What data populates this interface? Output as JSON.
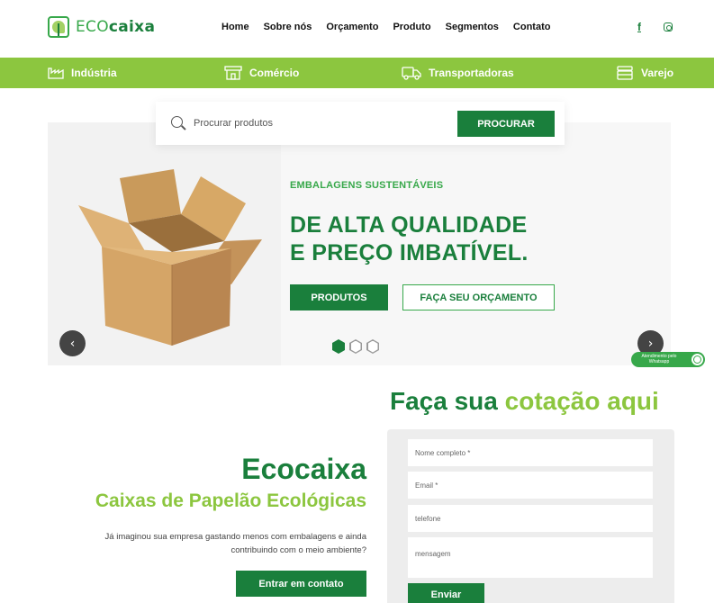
{
  "brand": {
    "logo_eco": "ECO",
    "logo_caixa": "caixa"
  },
  "nav": {
    "items": [
      {
        "label": "Home"
      },
      {
        "label": "Sobre nós"
      },
      {
        "label": "Orçamento"
      },
      {
        "label": "Produto"
      },
      {
        "label": "Segmentos"
      },
      {
        "label": "Contato"
      }
    ]
  },
  "social": {
    "facebook_glyph": "f",
    "icons": [
      "facebook-icon",
      "instagram-icon"
    ]
  },
  "categories": [
    {
      "label": "Indústria",
      "icon": "factory-icon"
    },
    {
      "label": "Comércio",
      "icon": "storefront-icon"
    },
    {
      "label": "Transportadoras",
      "icon": "truck-icon"
    },
    {
      "label": "Varejo",
      "icon": "store-icon"
    }
  ],
  "search": {
    "placeholder": "Procurar produtos",
    "button": "PROCURAR"
  },
  "hero": {
    "kicker": "EMBALAGENS SUSTENTÁVEIS",
    "title_line1": "DE ALTA QUALIDADE",
    "title_line2": "E PREÇO IMBATÍVEL.",
    "btn_primary": "PRODUTOS",
    "btn_secondary": "FAÇA SEU ORÇAMENTO",
    "slides_total": 3,
    "slide_active": 1,
    "prev_glyph": "‹",
    "next_glyph": "›"
  },
  "whatsapp": {
    "label_line1": "Atendimento pelo",
    "label_line2": "Whatsapp"
  },
  "about": {
    "title": "Ecocaixa",
    "subtitle": "Caixas de Papelão Ecológicas",
    "text": "Já imaginou sua empresa gastando menos com embalagens e ainda contribuindo com o meio ambiente?",
    "button": "Entrar em contato"
  },
  "quote": {
    "title_dark": "Faça sua",
    "title_light": "cotação aqui",
    "fields": {
      "name_placeholder": "Nome completo *",
      "email_placeholder": "Email *",
      "phone_placeholder": "telefone",
      "message_placeholder": "mensagem"
    },
    "submit": "Enviar"
  },
  "colors": {
    "primary_dark": "#1a7f3c",
    "primary_light": "#8cc63f"
  }
}
